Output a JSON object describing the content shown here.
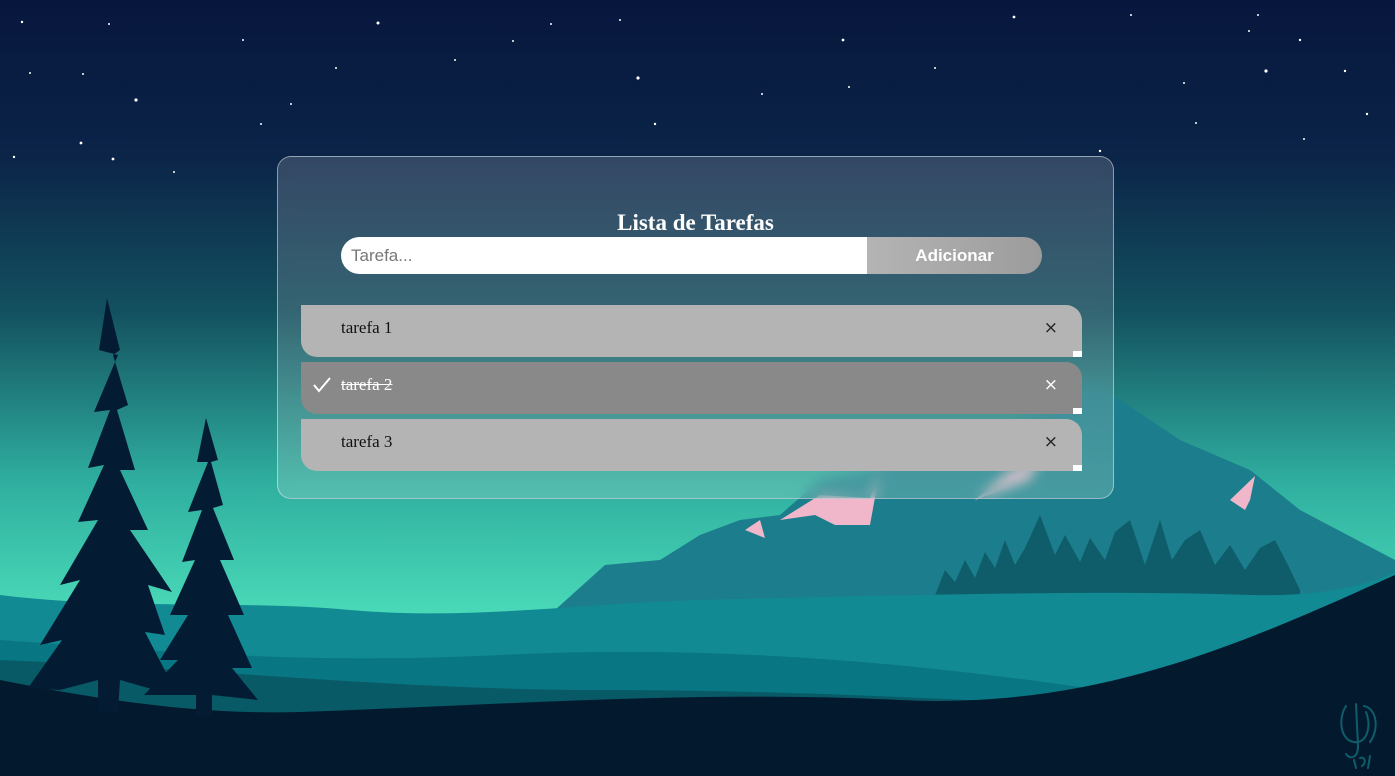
{
  "app": {
    "title": "Lista de Tarefas"
  },
  "form": {
    "input_value": "",
    "input_placeholder": "Tarefa...",
    "add_label": "Adicionar"
  },
  "tasks": [
    {
      "text": "tarefa 1",
      "done": false,
      "remove_label": "×"
    },
    {
      "text": "tarefa 2",
      "done": true,
      "remove_label": "×"
    },
    {
      "text": "tarefa 3",
      "done": false,
      "remove_label": "×"
    }
  ],
  "icons": {
    "check": "check-icon",
    "remove": "close-icon"
  },
  "colors": {
    "sky_top": "#07163d",
    "sky_glow": "#4bdcb9",
    "mountain": "#1c7e8c",
    "snow": "#efb7c9",
    "tree": "#041c33",
    "foreground": "#031a2e",
    "task_bg": "#b4b4b4",
    "task_done_bg": "#898989",
    "button_bg": "#a9a9a9"
  }
}
